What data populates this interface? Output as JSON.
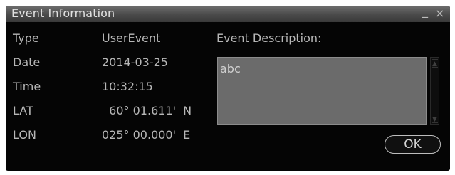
{
  "window": {
    "title": "Event Information",
    "minimize_glyph": "_",
    "close_glyph": "×"
  },
  "fields": [
    {
      "label": "Type",
      "value": "UserEvent"
    },
    {
      "label": "Date",
      "value": "2014-03-25"
    },
    {
      "label": "Time",
      "value": "10:32:15"
    },
    {
      "label": "LAT",
      "value": "  60° 01.611'  N"
    },
    {
      "label": "LON",
      "value": "025° 00.000'  E"
    }
  ],
  "description": {
    "label": "Event Description:",
    "text": "abc"
  },
  "buttons": {
    "ok": "OK"
  },
  "icons": {
    "minimize": "minimize-icon",
    "close": "close-icon",
    "scroll_up": "arrow-up-icon",
    "scroll_down": "arrow-down-icon"
  },
  "colors": {
    "background": "#050505",
    "title_bar": "#4a4a4a",
    "text": "#b7b7b7",
    "description_box": "#6b6b6b"
  }
}
